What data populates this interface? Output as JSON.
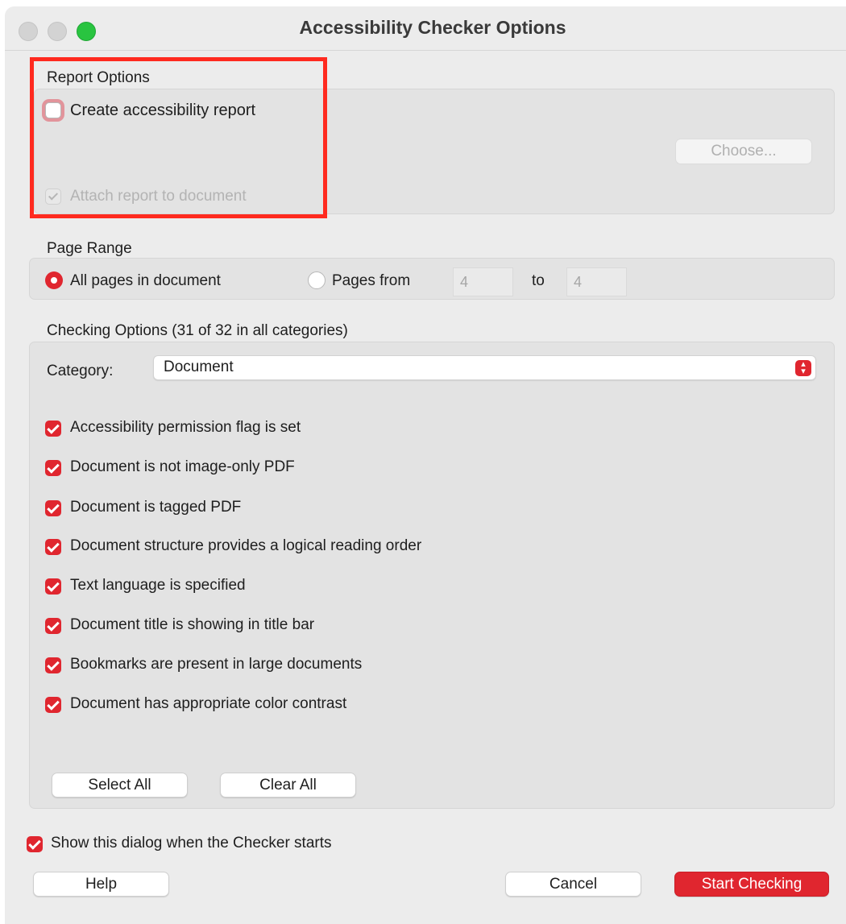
{
  "window": {
    "title": "Accessibility Checker Options"
  },
  "report_options": {
    "heading": "Report Options",
    "create_report_label": "Create accessibility report",
    "create_report_checked": false,
    "choose_button": "Choose...",
    "attach_report_label": "Attach report to document",
    "attach_report_checked": true
  },
  "page_range": {
    "heading": "Page Range",
    "all_pages_label": "All pages in document",
    "all_pages_selected": true,
    "pages_from_label": "Pages from",
    "from_value": "4",
    "to_label": "to",
    "to_value": "4"
  },
  "checking_options": {
    "heading": "Checking Options (31 of 32 in all categories)",
    "category_label": "Category:",
    "category_value": "Document",
    "items": [
      {
        "label": "Accessibility permission flag is set",
        "checked": true
      },
      {
        "label": "Document is not image-only PDF",
        "checked": true
      },
      {
        "label": "Document is tagged PDF",
        "checked": true
      },
      {
        "label": "Document structure provides a logical reading order",
        "checked": true
      },
      {
        "label": "Text language is specified",
        "checked": true
      },
      {
        "label": "Document title is showing in title bar",
        "checked": true
      },
      {
        "label": "Bookmarks are present in large documents",
        "checked": true
      },
      {
        "label": "Document has appropriate color contrast",
        "checked": true
      }
    ],
    "select_all": "Select All",
    "clear_all": "Clear All"
  },
  "footer": {
    "show_dialog_label": "Show this dialog when the Checker starts",
    "show_dialog_checked": true,
    "help": "Help",
    "cancel": "Cancel",
    "start": "Start Checking"
  },
  "colors": {
    "accent": "#e0262f",
    "highlight_box": "#ff2a1f"
  }
}
